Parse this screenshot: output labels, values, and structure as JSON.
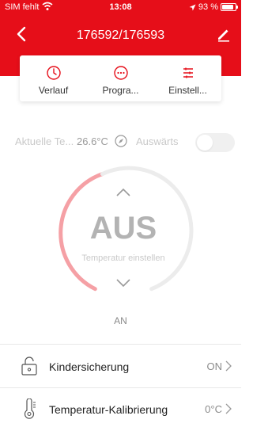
{
  "status_bar": {
    "carrier": "SIM fehlt",
    "time": "13:08",
    "battery": "93 %"
  },
  "nav": {
    "title": "176592/176593"
  },
  "tabs": [
    {
      "label": "Verlauf",
      "icon": "clock-icon"
    },
    {
      "label": "Progra...",
      "icon": "program-icon"
    },
    {
      "label": "Einstell...",
      "icon": "settings-lines-icon"
    }
  ],
  "info": {
    "current_temp_label": "Aktuelle Te...",
    "current_temp_value": "26.6°C",
    "away_label": "Auswärts",
    "away_on": false
  },
  "dial": {
    "state": "AUS",
    "hint": "Temperatur einstellen",
    "on_label": "AN",
    "accent_color": "#f5a0a5",
    "track_color": "#ececec"
  },
  "settings": [
    {
      "label": "Kindersicherung",
      "value": "ON",
      "icon": "lock-icon"
    },
    {
      "label": "Temperatur-Kalibrierung",
      "value": "0°C",
      "icon": "thermometer-icon"
    }
  ],
  "colors": {
    "brand": "#e60e19",
    "text_muted": "#8a8a8a"
  }
}
